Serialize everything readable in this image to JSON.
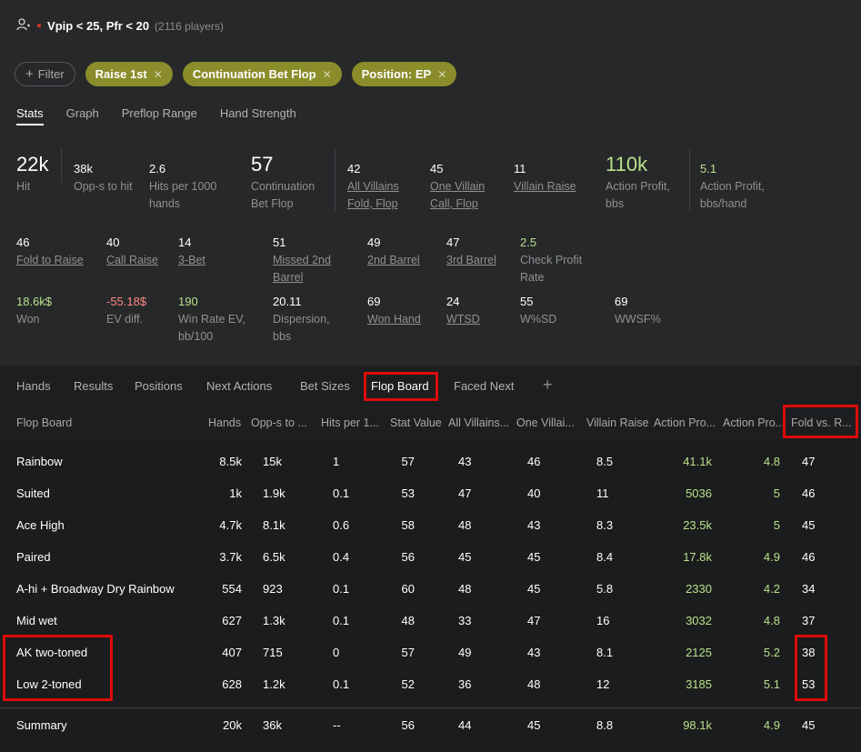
{
  "header": {
    "title": "Vpip < 25, Pfr < 20",
    "count": "(2116 players)"
  },
  "filter_label": "Filter",
  "chips": [
    "Raise 1st",
    "Continuation Bet Flop",
    "Position: EP"
  ],
  "stat_tabs": [
    "Stats",
    "Graph",
    "Preflop Range",
    "Hand Strength"
  ],
  "stats_row1": [
    {
      "value": "22k",
      "label": "Hit"
    },
    {
      "value": "38k",
      "label": "Opp-s to hit"
    },
    {
      "value": "2.6",
      "label": "Hits per 1000 hands"
    },
    {
      "value": "57",
      "label": "Continuation Bet Flop"
    },
    {
      "value": "42",
      "label": "All Villains Fold, Flop"
    },
    {
      "value": "45",
      "label": "One Villain Call, Flop"
    },
    {
      "value": "11",
      "label": "Villain Raise"
    },
    {
      "value": "110k",
      "label": "Action Profit, bbs"
    },
    {
      "value": "5.1",
      "label": "Action Profit, bbs/hand"
    }
  ],
  "stats_row2": [
    {
      "value": "46",
      "label": "Fold to Raise"
    },
    {
      "value": "40",
      "label": "Call Raise"
    },
    {
      "value": "14",
      "label": "3-Bet"
    },
    {
      "value": "51",
      "label": "Missed 2nd Barrel"
    },
    {
      "value": "49",
      "label": "2nd Barrel"
    },
    {
      "value": "47",
      "label": "3rd Barrel"
    },
    {
      "value": "2.5",
      "label": "Check Profit Rate"
    }
  ],
  "stats_row3": [
    {
      "value": "18.6k$",
      "label": "Won"
    },
    {
      "value": "-55.18$",
      "label": "EV diff."
    },
    {
      "value": "190",
      "label": "Win Rate EV, bb/100"
    },
    {
      "value": "20.11",
      "label": "Dispersion, bbs"
    },
    {
      "value": "69",
      "label": "Won Hand"
    },
    {
      "value": "24",
      "label": "WTSD"
    },
    {
      "value": "55",
      "label": "W%SD"
    },
    {
      "value": "69",
      "label": "WWSF%"
    }
  ],
  "table_tabs": [
    "Hands",
    "Results",
    "Positions",
    "Next Actions",
    "Bet Sizes",
    "Flop Board",
    "Faced Next"
  ],
  "add_tab": "+",
  "columns": [
    "Flop Board",
    "Hands",
    "Opp-s to ...",
    "Hits per 1...",
    "Stat Value",
    "All Villains...",
    "One Villai...",
    "Villain Raise",
    "Action Pro...",
    "Action Pro...",
    "Fold vs. R..."
  ],
  "rows": [
    [
      "Rainbow",
      "8.5k",
      "15k",
      "1",
      "57",
      "43",
      "46",
      "8.5",
      "41.1k",
      "4.8",
      "47"
    ],
    [
      "Suited",
      "1k",
      "1.9k",
      "0.1",
      "53",
      "47",
      "40",
      "11",
      "5036",
      "5",
      "46"
    ],
    [
      "Ace High",
      "4.7k",
      "8.1k",
      "0.6",
      "58",
      "48",
      "43",
      "8.3",
      "23.5k",
      "5",
      "45"
    ],
    [
      "Paired",
      "3.7k",
      "6.5k",
      "0.4",
      "56",
      "45",
      "45",
      "8.4",
      "17.8k",
      "4.9",
      "46"
    ],
    [
      "A-hi + Broadway Dry Rainbow",
      "554",
      "923",
      "0.1",
      "60",
      "48",
      "45",
      "5.8",
      "2330",
      "4.2",
      "34"
    ],
    [
      "Mid wet",
      "627",
      "1.3k",
      "0.1",
      "48",
      "33",
      "47",
      "16",
      "3032",
      "4.8",
      "37"
    ],
    [
      "AK two-toned",
      "407",
      "715",
      "0",
      "57",
      "49",
      "43",
      "8.1",
      "2125",
      "5.2",
      "38"
    ],
    [
      "Low 2-toned",
      "628",
      "1.2k",
      "0.1",
      "52",
      "36",
      "48",
      "12",
      "3185",
      "5.1",
      "53"
    ]
  ],
  "summary": [
    "Summary",
    "20k",
    "36k",
    "--",
    "56",
    "44",
    "45",
    "8.8",
    "98.1k",
    "4.9",
    "45"
  ],
  "colors": {
    "accent_green": "#b8e08a",
    "chip_bg": "#8a8d2a",
    "highlight_red": "#dd0b0b",
    "negative": "#ff8a80"
  }
}
